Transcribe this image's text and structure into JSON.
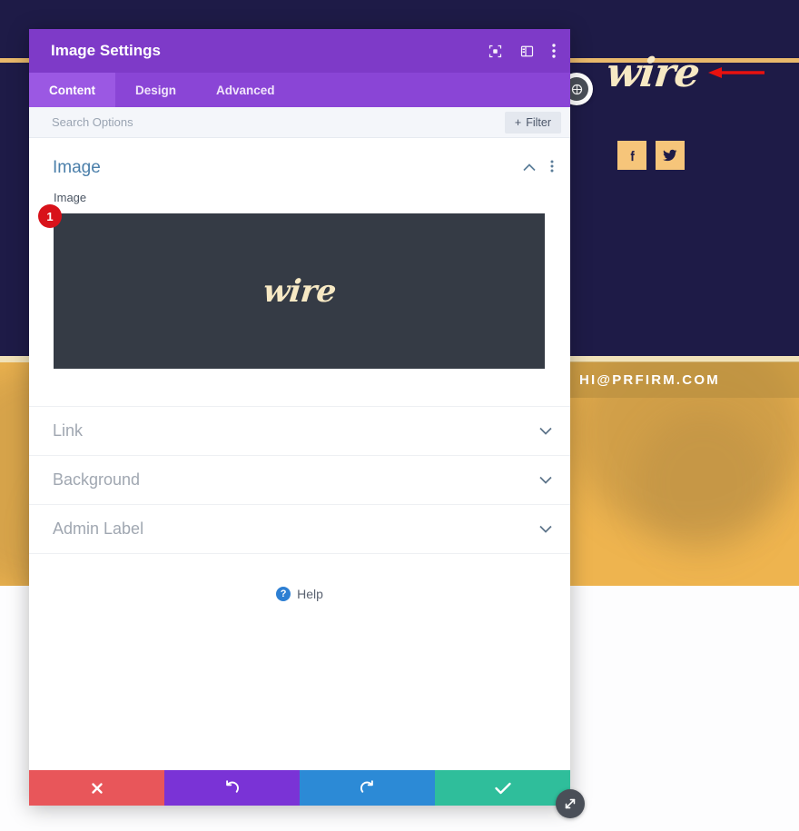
{
  "background_page": {
    "logo_text": "wire",
    "email_text": "HI@PRFIRM.COM",
    "social": [
      {
        "name": "facebook",
        "glyph": "f"
      },
      {
        "name": "twitter",
        "glyph": "✓"
      }
    ],
    "arrow_color": "#e8110f",
    "navy_color": "#1e1b47",
    "gold_color": "#eeb44f",
    "cream_color": "#f7e9c4"
  },
  "modal": {
    "title": "Image Settings",
    "header_icons": [
      {
        "name": "focus-icon",
        "label": "Focus"
      },
      {
        "name": "layout-icon",
        "label": "Layout"
      },
      {
        "name": "more-vertical-icon",
        "label": "More"
      }
    ],
    "tabs": [
      {
        "label": "Content",
        "active": true
      },
      {
        "label": "Design",
        "active": false
      },
      {
        "label": "Advanced",
        "active": false
      }
    ],
    "search": {
      "placeholder": "Search Options",
      "value": ""
    },
    "filter_button": {
      "label": "Filter",
      "plus": "+"
    },
    "open_section": {
      "title": "Image",
      "field_label": "Image",
      "preview_logo": "wire",
      "badge": "1"
    },
    "collapsed_sections": [
      {
        "label": "Link"
      },
      {
        "label": "Background"
      },
      {
        "label": "Admin Label"
      }
    ],
    "help": {
      "label": "Help",
      "icon_glyph": "?"
    },
    "footer_buttons": [
      {
        "name": "cancel-button",
        "icon": "✖",
        "color": "#e8565a"
      },
      {
        "name": "undo-button",
        "icon": "↺",
        "color": "#7a33d6"
      },
      {
        "name": "redo-button",
        "icon": "↻",
        "color": "#2c8ad6"
      },
      {
        "name": "save-button",
        "icon": "✔",
        "color": "#2fbe9b"
      }
    ]
  },
  "colors": {
    "header_purple": "#7e3ac8",
    "tabbar_purple": "#8a45d6",
    "active_tab_purple": "#9b58e3",
    "badge_red": "#d8121a",
    "image_bg": "#353b45",
    "section_title_blue": "#4b7faa"
  }
}
